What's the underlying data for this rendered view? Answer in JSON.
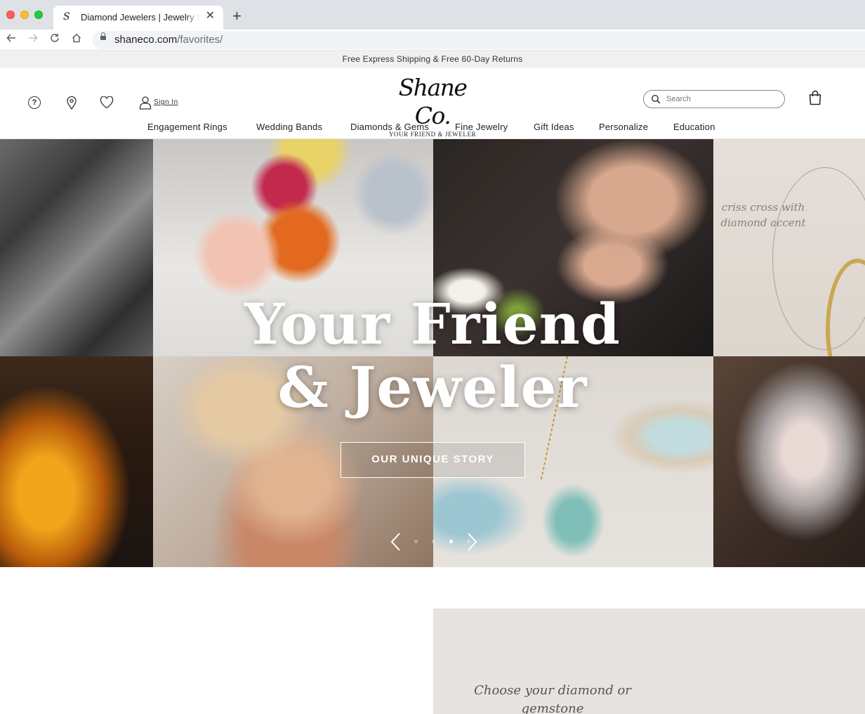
{
  "browser": {
    "tab_title": "Diamond Jewelers | Jewelry Store",
    "tab_favicon": "S",
    "url_domain": "shaneco.com",
    "url_path": "/favorites/"
  },
  "promo": {
    "text": "Free Express Shipping & Free 60-Day Returns"
  },
  "header": {
    "sign_in": "Sign In",
    "logo_text": "Shane Co.",
    "logo_tagline": "YOUR FRIEND & JEWELER",
    "search_placeholder": "Search",
    "icons": [
      "help-icon",
      "location-icon",
      "heart-icon",
      "user-icon",
      "search-icon",
      "shopping-bag-icon"
    ]
  },
  "nav": {
    "items": [
      "Engagement Rings",
      "Wedding Bands",
      "Diamonds & Gems",
      "Fine Jewelry",
      "Gift Ideas",
      "Personalize",
      "Education"
    ]
  },
  "hero": {
    "title_line1": "Your Friend",
    "title_line2": "& Jeweler",
    "cta_label": "OUR UNIQUE STORY",
    "sketch_note": "criss cross with diamond accent",
    "slide_count": 4,
    "active_slide": 3
  },
  "below": {
    "story_note": "Choose your diamond or gemstone"
  },
  "colors": {
    "promo_bg": "#f1f0ef",
    "text": "#222222",
    "cta_border": "#ffffff"
  }
}
